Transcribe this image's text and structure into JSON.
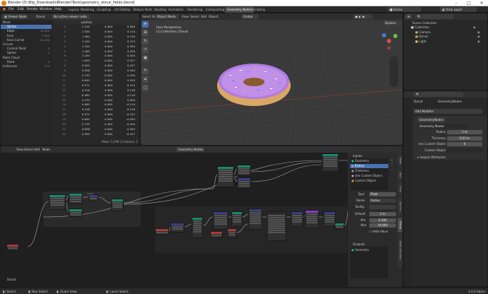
{
  "window": {
    "title": "Blender [D:\\Big_Downloads\\Blender\\Tests\\geometry_donut_fields.blend]"
  },
  "menu": [
    "File",
    "Edit",
    "Render",
    "Window",
    "Help"
  ],
  "workspaces": [
    "Layout",
    "Modeling",
    "Sculpting",
    "UV Editing",
    "Texture Paint",
    "Shading",
    "Animation",
    "Rendering",
    "Compositing",
    "Geometry Nodes",
    "Scripting"
  ],
  "active_workspace": "Geometry Nodes",
  "top_right": {
    "scene_label": "Scene",
    "view_layer_label": "View Layer"
  },
  "spreadsheet": {
    "editor": "Viewer Node",
    "object": "Donut",
    "no_active_viewer": "No active viewer node",
    "domains": [
      {
        "label": "Mesh",
        "count": ""
      },
      {
        "label": "Vertex",
        "count": "5,290"
      },
      {
        "label": "Edge",
        "count": "10,580"
      },
      {
        "label": "Face",
        "count": "5,290"
      },
      {
        "label": "Face Corner",
        "count": "21,160"
      },
      {
        "label": "Curves",
        "count": ""
      },
      {
        "label": "Control Point",
        "count": "0"
      },
      {
        "label": "Spline",
        "count": "0"
      },
      {
        "label": "Point Cloud",
        "count": ""
      },
      {
        "label": "Point",
        "count": "0"
      },
      {
        "label": "Instances",
        "count": "274"
      }
    ],
    "column_header": "position",
    "rows": [
      [
        "0",
        "1.510",
        "0.000",
        "0.000"
      ],
      [
        "1",
        "1.500",
        "0.000",
        "0.110"
      ],
      [
        "2",
        "1.464",
        "0.000",
        "0.216"
      ],
      [
        "3",
        "1.429",
        "0.000",
        "0.313"
      ],
      [
        "4",
        "1.355",
        "0.000",
        "0.394"
      ],
      [
        "5",
        "1.265",
        "0.000",
        "0.459"
      ],
      [
        "6",
        "1.164",
        "0.000",
        "0.504"
      ],
      [
        "7",
        "1.055",
        "0.000",
        "0.527"
      ],
      [
        "8",
        "0.945",
        "0.000",
        "0.527"
      ],
      [
        "9",
        "0.836",
        "0.000",
        "0.504"
      ],
      [
        "10",
        "0.735",
        "0.000",
        "0.459"
      ],
      [
        "11",
        "0.645",
        "0.000",
        "0.394"
      ],
      [
        "12",
        "0.571",
        "0.000",
        "0.312"
      ],
      [
        "13",
        "0.516",
        "0.000",
        "0.216"
      ],
      [
        "14",
        "0.482",
        "0.000",
        "0.110"
      ],
      [
        "15",
        "0.470",
        "0.000",
        "0.000"
      ],
      [
        "16",
        "0.482",
        "0.000",
        "-0.110"
      ],
      [
        "17",
        "0.516",
        "0.000",
        "-0.216"
      ],
      [
        "18",
        "0.571",
        "0.000",
        "-0.312"
      ],
      [
        "19",
        "0.645",
        "0.000",
        "-0.394"
      ],
      [
        "20",
        "0.735",
        "0.000",
        "-0.459"
      ],
      [
        "21",
        "0.836",
        "0.000",
        "-0.504"
      ],
      [
        "22",
        "0.945",
        "0.000",
        "-0.527"
      ]
    ],
    "footer": "Rows: 5,290 | Columns: 1"
  },
  "viewport": {
    "header": {
      "select_box": "Select Box",
      "mode": "Object Mode",
      "menus": [
        "View",
        "Select",
        "Add",
        "Object"
      ],
      "orientation": "Global",
      "options": "Options"
    },
    "overlay_line1": "User Perspective",
    "overlay_line2": "(1) Collection | Donut",
    "tool_icons": [
      "cursor-icon",
      "move-icon",
      "rotate-icon",
      "scale-icon",
      "transform-icon",
      "annotate-icon",
      "measure-icon",
      "add-cube-icon"
    ]
  },
  "outliner": {
    "title": "Scene Collection",
    "items": [
      {
        "label": "Collection",
        "indent": 1
      },
      {
        "label": "Camera",
        "indent": 2
      },
      {
        "label": "Donut",
        "indent": 2
      },
      {
        "label": "Light",
        "indent": 2
      }
    ]
  },
  "properties": {
    "object_name": "Donut",
    "modifier_name": "GeometryNodes",
    "add_modifier": "Add Modifier",
    "node_group": "Geometry Nodes",
    "fields": [
      {
        "label": "Radius",
        "value": "1 m"
      },
      {
        "label": "Thickness",
        "value": "0.53 m"
      },
      {
        "label": "Use Custom Object",
        "value": "0"
      },
      {
        "label": "Custom Object",
        "value": ""
      }
    ],
    "output_attributes": "Output Attributes"
  },
  "node_editor": {
    "header": {
      "menus": [
        "View",
        "Select",
        "Add",
        "Node"
      ],
      "tree": "Geometry Nodes"
    },
    "frame_label": "Donut",
    "group_label": "Shape"
  },
  "node_sidebar": {
    "inputs_title": "Inputs",
    "inputs": [
      "Geometry",
      "Radius",
      "Thickness",
      "Use Custom Object",
      "Custom Object"
    ],
    "selected_input": "Radius",
    "type_label": "Type",
    "type_value": "Float",
    "name_label": "Name",
    "name_value": "Radius",
    "tooltip_label": "Tooltip",
    "default_label": "Default",
    "default_value": "1 m",
    "min_label": "Min",
    "min_value": "0.100",
    "max_label": "Max",
    "max_value": "10.000",
    "hide_value": "Hide Value",
    "outputs_title": "Outputs",
    "outputs": [
      "Geometry"
    ],
    "tabs": [
      "Node",
      "Tool",
      "View",
      "Options",
      "Group",
      "Node Wrangler"
    ]
  },
  "status_bar": {
    "items": [
      "Select",
      "Box Select",
      "Zoom View",
      "Lasso Select"
    ],
    "version": "3.4.0 Alpha"
  },
  "colors": {
    "accent": "#4772b3",
    "donut_icing": "#b07be0",
    "dough": "#d9a766",
    "geometry_socket": "#00d6a3",
    "float_socket": "#a1a1a1"
  }
}
